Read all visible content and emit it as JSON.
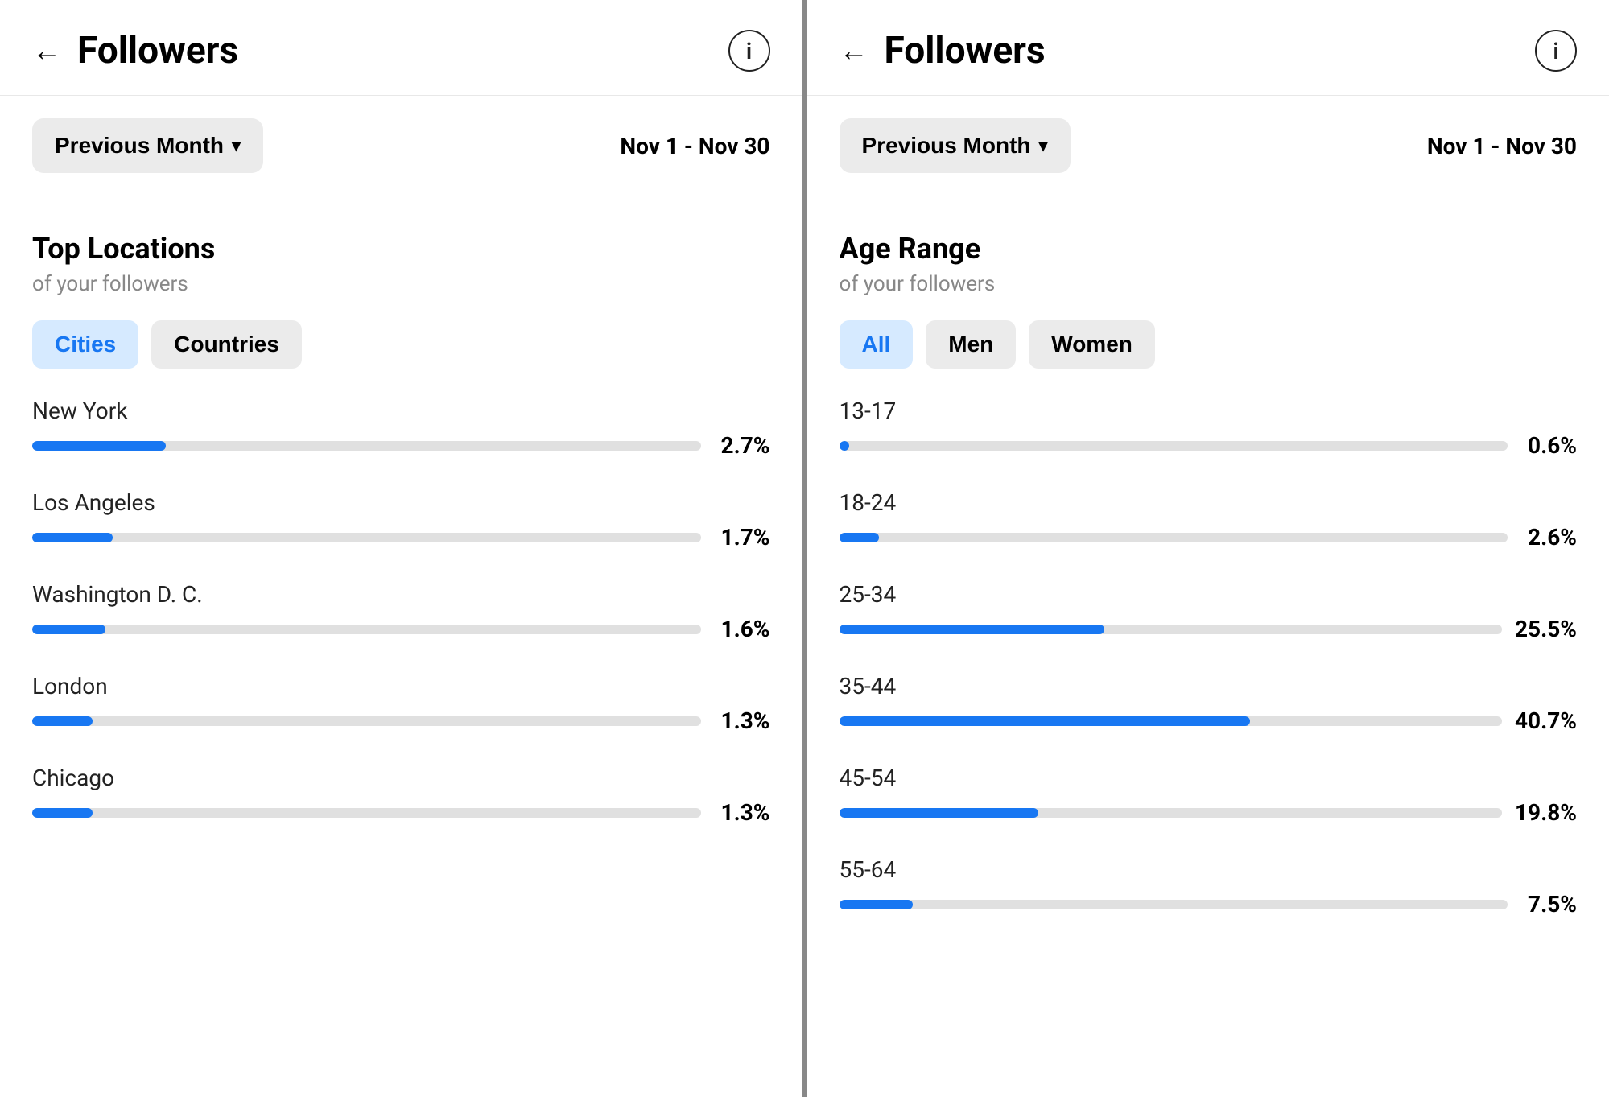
{
  "left_panel": {
    "header": {
      "title": "Followers",
      "back_label": "←",
      "info_label": "i"
    },
    "filter": {
      "period_label": "Previous Month",
      "chevron": "▾",
      "date_range": "Nov 1 - Nov 30"
    },
    "section_title": "Top Locations",
    "section_subtitle": "of your followers",
    "tabs": [
      {
        "id": "cities",
        "label": "Cities",
        "active": true
      },
      {
        "id": "countries",
        "label": "Countries",
        "active": false
      }
    ],
    "locations": [
      {
        "name": "New York",
        "pct": "2.7%",
        "fill_pct": 20
      },
      {
        "name": "Los Angeles",
        "pct": "1.7%",
        "fill_pct": 12
      },
      {
        "name": "Washington D. C.",
        "pct": "1.6%",
        "fill_pct": 11
      },
      {
        "name": "London",
        "pct": "1.3%",
        "fill_pct": 9
      },
      {
        "name": "Chicago",
        "pct": "1.3%",
        "fill_pct": 9
      }
    ]
  },
  "right_panel": {
    "header": {
      "title": "Followers",
      "back_label": "←",
      "info_label": "i"
    },
    "filter": {
      "period_label": "Previous Month",
      "chevron": "▾",
      "date_range": "Nov 1 - Nov 30"
    },
    "section_title": "Age Range",
    "section_subtitle": "of your followers",
    "tabs": [
      {
        "id": "all",
        "label": "All",
        "active": true
      },
      {
        "id": "men",
        "label": "Men",
        "active": false
      },
      {
        "id": "women",
        "label": "Women",
        "active": false
      }
    ],
    "age_ranges": [
      {
        "range": "13-17",
        "pct": "0.6%",
        "fill_pct": 1.5
      },
      {
        "range": "18-24",
        "pct": "2.6%",
        "fill_pct": 6
      },
      {
        "range": "25-34",
        "pct": "25.5%",
        "fill_pct": 40
      },
      {
        "range": "35-44",
        "pct": "40.7%",
        "fill_pct": 62
      },
      {
        "range": "45-54",
        "pct": "19.8%",
        "fill_pct": 30
      },
      {
        "range": "55-64",
        "pct": "7.5%",
        "fill_pct": 11
      }
    ]
  },
  "colors": {
    "blue": "#1877f2",
    "active_tab_bg": "#d6eaff",
    "tab_bg": "#ebebeb",
    "bar_track": "#e0e0e0"
  }
}
